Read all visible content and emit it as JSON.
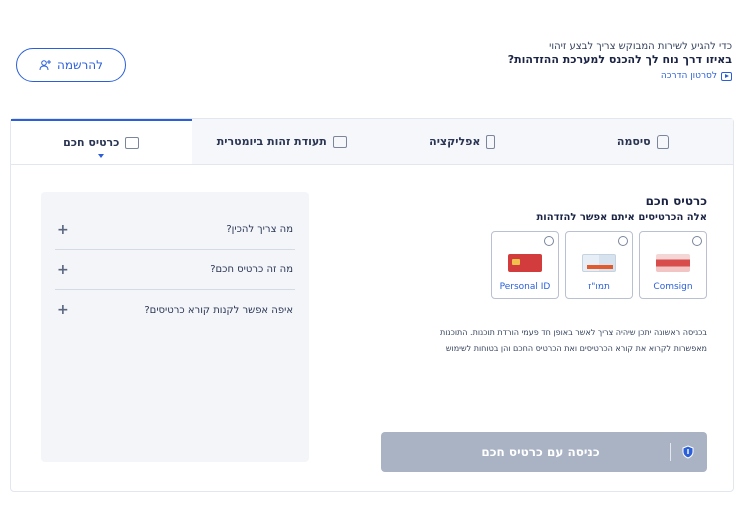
{
  "header": {
    "intro": "כדי להגיע לשירות המבוקש צריך לבצע זיהוי",
    "question": "באיזו דרך נוח לך להכנס למערכת ההזדהות?",
    "video_link": "לסרטון הדרכה",
    "register_label": "להרשמה"
  },
  "tabs": [
    {
      "label": "סיסמה",
      "icon": "lock-icon"
    },
    {
      "label": "אפליקציה",
      "icon": "phone-icon"
    },
    {
      "label": "תעודת זהות ביומטרית",
      "icon": "id-card-icon"
    },
    {
      "label": "כרטיס חכם",
      "icon": "smart-card-icon",
      "active": true
    }
  ],
  "smart_card": {
    "title": "כרטיס חכם",
    "subtitle": "אלה הכרטיסים איתם אפשר להזדהות",
    "options": [
      {
        "label": "Comsign"
      },
      {
        "label": "תמו\"ז"
      },
      {
        "label": "Personal ID"
      }
    ],
    "note_line1": "בכניסה ראשונה יתכן שיהיה צריך לאשר באופן חד פעמי הורדת תוכנות. התוכנות",
    "note_line2": "מאפשרות לקרוא את קורא הכרטיסים ואת הכרטיס החכם והן בטוחות לשימוש",
    "enter_button": "כניסה עם כרטיס חכם"
  },
  "faq": {
    "items": [
      {
        "question": "מה צריך להכין?"
      },
      {
        "question": "מה זה כרטיס חכם?"
      },
      {
        "question": "איפה אפשר לקנות קורא כרטיסים?"
      }
    ],
    "expand_symbol": "+"
  },
  "colors": {
    "accent": "#2b5fd9",
    "disabled_button": "#a9b3c4",
    "faq_bg": "#f3f5f9"
  }
}
